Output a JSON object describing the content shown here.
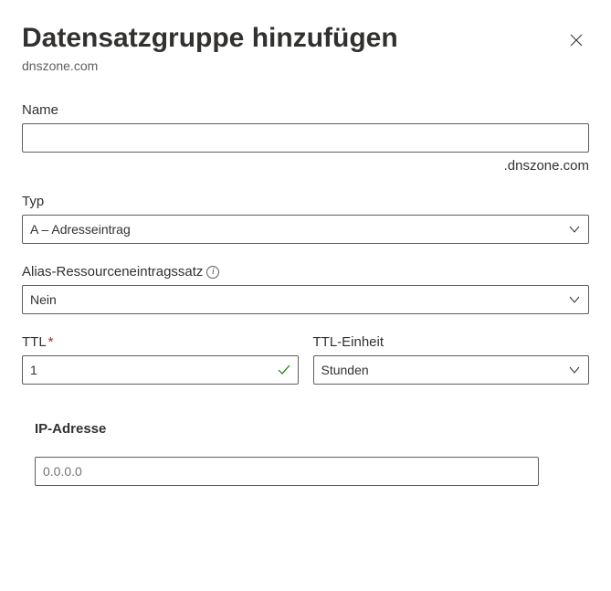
{
  "header": {
    "title": "Datensatzgruppe hinzufügen",
    "subtitle": "dnszone.com"
  },
  "name_field": {
    "label": "Name",
    "value": "",
    "suffix": ".dnszone.com"
  },
  "type_field": {
    "label": "Typ",
    "value": "A – Adresseintrag"
  },
  "alias_field": {
    "label": "Alias-Ressourceneintragssatz",
    "value": "Nein"
  },
  "ttl_field": {
    "label": "TTL",
    "value": "1"
  },
  "ttl_unit_field": {
    "label": "TTL-Einheit",
    "value": "Stunden"
  },
  "ip_field": {
    "label": "IP-Adresse",
    "placeholder": "0.0.0.0",
    "value": ""
  }
}
